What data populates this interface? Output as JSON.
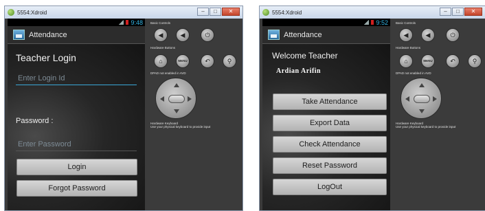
{
  "left": {
    "window_title": "5554:Xdroid",
    "clock": "9:48",
    "app_title": "Attendance",
    "heading": "Teacher Login",
    "login_placeholder": "Enter Login Id",
    "password_label": "Password :",
    "password_placeholder": "Enter Password",
    "login_button": "Login",
    "forgot_button": "Forgot Password"
  },
  "right": {
    "window_title": "5554:Xdroid",
    "clock": "9:52",
    "app_title": "Attendance",
    "heading": "Welcome Teacher",
    "teacher_name": "Ardian Arifin",
    "buttons": [
      "Take Attendance",
      "Export Data",
      "Check Attendance",
      "Reset Password",
      "LogOut"
    ]
  },
  "emulator_controls": {
    "basic_controls_label": "Basic Controls",
    "hardware_buttons_label": "Hardware Buttons",
    "dpad_note": "DPAD not enabled in AVD",
    "keyboard_note_1": "Hardware Keyboard",
    "keyboard_note_2": "Use your physical keyboard to provide input",
    "menu_label": "MENU",
    "icons": [
      "volume-down-icon",
      "volume-up-icon",
      "power-icon",
      "home-icon",
      "menu-icon",
      "back-icon",
      "search-icon"
    ]
  },
  "colors": {
    "accent": "#33b5e5",
    "input_underline": "#3aa8d8",
    "close_button": "#c4452b"
  }
}
